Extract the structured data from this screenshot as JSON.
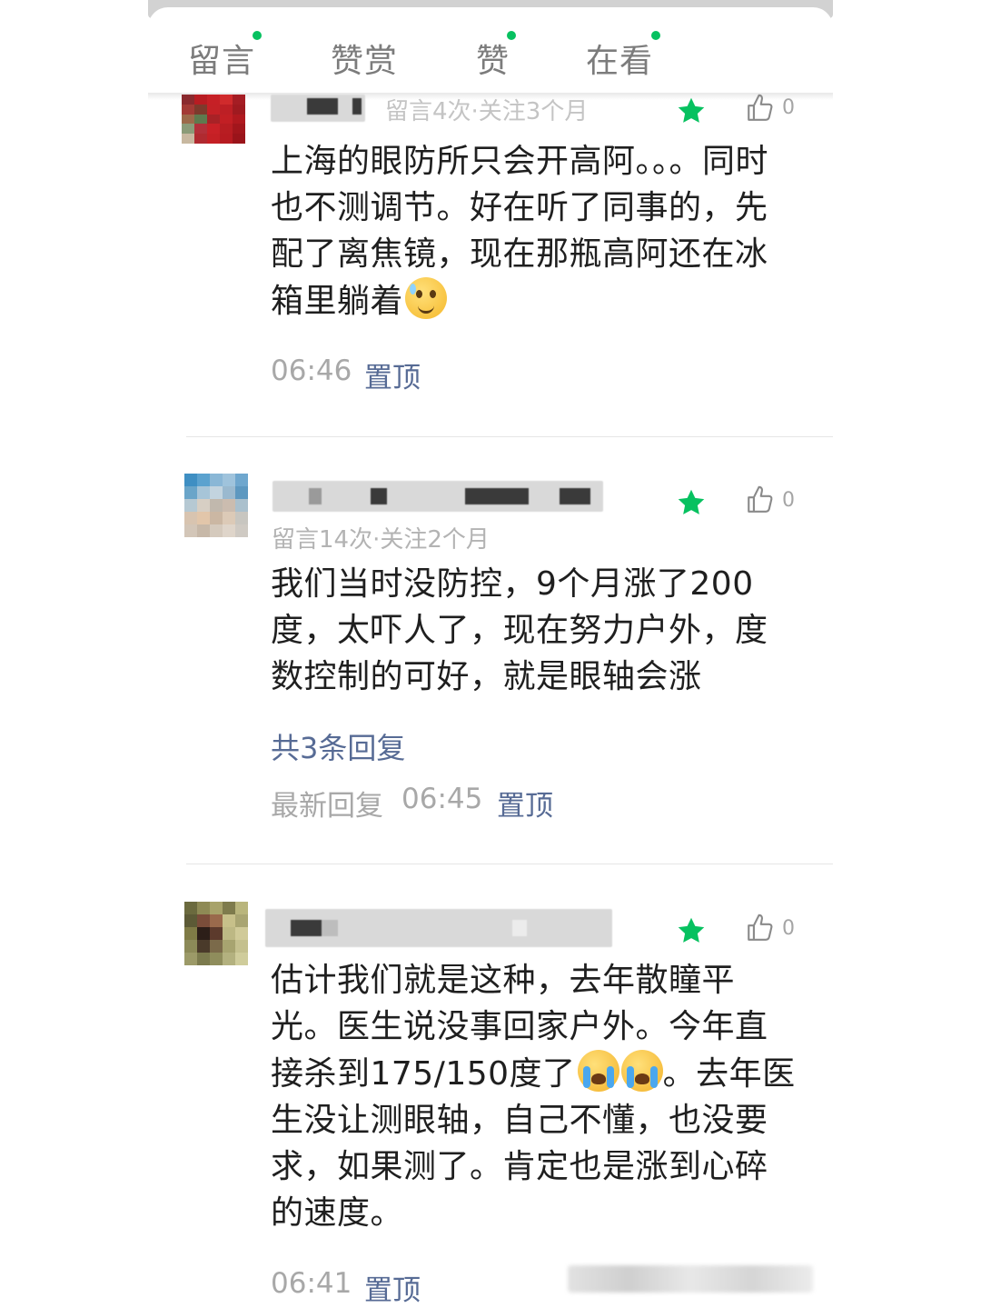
{
  "tabs": [
    {
      "label": "留言",
      "has_dot": true
    },
    {
      "label": "赞赏",
      "has_dot": false
    },
    {
      "label": "赞",
      "has_dot": true
    },
    {
      "label": "在看",
      "has_dot": true
    }
  ],
  "colors": {
    "accent_green": "#07c160",
    "link_blue": "#576b95",
    "meta_gray": "#b3b3b3",
    "text_dark": "#1f1f1f"
  },
  "icons": {
    "star": "star-icon",
    "like": "thumbs-up-icon",
    "tab_dot": "notification-dot-icon"
  },
  "comments": [
    {
      "meta": "留言4次·关注3个月",
      "like_count": "0",
      "text": "上海的眼防所只会开高阿。。。同时也不测调节。好在听了同事的，先配了离焦镜，现在那瓶高阿还在冰箱里躺着",
      "emoji": "sweat-smile-emoji",
      "time": "06:46",
      "pin_label": "置顶"
    },
    {
      "meta": "留言14次·关注2个月",
      "like_count": "0",
      "text": "我们当时没防控，9个月涨了200度，太吓人了，现在努力户外，度数控制的可好，就是眼轴会涨",
      "replies_label": "共3条回复",
      "latest_reply_label": "最新回复",
      "time": "06:45",
      "pin_label": "置顶"
    },
    {
      "meta": "",
      "like_count": "0",
      "text_part1": "估计我们就是这种，去年散瞳平光。医生说没事回家户外。今年直接杀到175/150度了",
      "emoji": "loudly-crying-emoji",
      "text_part2": "。去年医生没让测眼轴，自己不懂，也没要求，如果测了。肯定也是涨到心碎的速度。",
      "time": "06:41",
      "pin_label": "置顶"
    }
  ]
}
